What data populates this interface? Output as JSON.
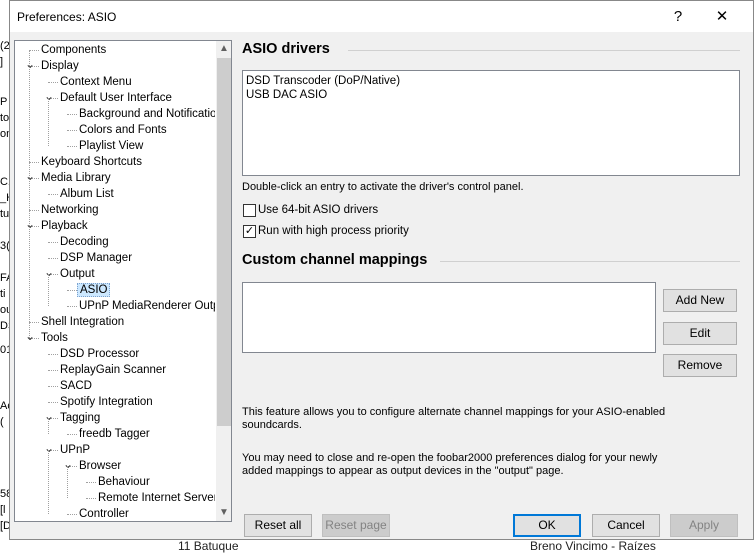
{
  "window": {
    "title": "Preferences: ASIO",
    "help_glyph": "?",
    "close_glyph": "✕"
  },
  "tree": {
    "items": [
      {
        "label": "Components",
        "level": 0
      },
      {
        "label": "Display",
        "level": 0,
        "expanded": true
      },
      {
        "label": "Context Menu",
        "level": 1
      },
      {
        "label": "Default User Interface",
        "level": 1,
        "expanded": true
      },
      {
        "label": "Background and Notifications",
        "level": 2
      },
      {
        "label": "Colors and Fonts",
        "level": 2
      },
      {
        "label": "Playlist View",
        "level": 2
      },
      {
        "label": "Keyboard Shortcuts",
        "level": 0
      },
      {
        "label": "Media Library",
        "level": 0,
        "expanded": true
      },
      {
        "label": "Album List",
        "level": 1
      },
      {
        "label": "Networking",
        "level": 0
      },
      {
        "label": "Playback",
        "level": 0,
        "expanded": true
      },
      {
        "label": "Decoding",
        "level": 1
      },
      {
        "label": "DSP Manager",
        "level": 1
      },
      {
        "label": "Output",
        "level": 1,
        "expanded": true
      },
      {
        "label": "ASIO",
        "level": 2,
        "selected": true
      },
      {
        "label": "UPnP MediaRenderer Output",
        "level": 2
      },
      {
        "label": "Shell Integration",
        "level": 0
      },
      {
        "label": "Tools",
        "level": 0,
        "expanded": true
      },
      {
        "label": "DSD Processor",
        "level": 1
      },
      {
        "label": "ReplayGain Scanner",
        "level": 1
      },
      {
        "label": "SACD",
        "level": 1
      },
      {
        "label": "Spotify Integration",
        "level": 1
      },
      {
        "label": "Tagging",
        "level": 1,
        "expanded": true
      },
      {
        "label": "freedb Tagger",
        "level": 2
      },
      {
        "label": "UPnP",
        "level": 1,
        "expanded": true
      },
      {
        "label": "Browser",
        "level": 2,
        "expanded": true
      },
      {
        "label": "Behaviour",
        "level": 3
      },
      {
        "label": "Remote Internet Servers",
        "level": 3
      },
      {
        "label": "Controller",
        "level": 2
      }
    ]
  },
  "asio": {
    "heading": "ASIO drivers",
    "drivers": [
      "DSD Transcoder (DoP/Native)",
      "USB DAC ASIO"
    ],
    "hint": "Double-click an entry to activate the driver's control panel.",
    "opt_64bit": {
      "label": "Use 64-bit ASIO drivers",
      "checked": false
    },
    "opt_priority": {
      "label": "Run with high process priority",
      "checked": true
    }
  },
  "mappings": {
    "heading": "Custom channel mappings",
    "add_label": "Add New",
    "edit_label": "Edit",
    "remove_label": "Remove",
    "info1": "This feature allows you to configure alternate channel mappings for your ASIO-enabled soundcards.",
    "info2": "You may need to close and re-open the foobar2000 preferences dialog for your newly added mappings to appear as output devices in the \"output\" page."
  },
  "footer": {
    "reset_all": "Reset all",
    "reset_page": "Reset page",
    "ok": "OK",
    "cancel": "Cancel",
    "apply": "Apply"
  },
  "background": {
    "left_fragments": [
      "(2",
      "]",
      "P",
      "to",
      "on",
      "C1",
      "_H",
      "tu",
      "3(",
      "FA",
      "ti",
      "ou",
      "DS",
      "01",
      "Ac",
      "(",
      "58",
      "[l",
      "[D"
    ],
    "bottom_left": "11  Batuque",
    "bottom_right": "Breno Vincimo - Raízes"
  },
  "colors": {
    "selection": "#cce8ff",
    "accent": "#0078d7"
  }
}
